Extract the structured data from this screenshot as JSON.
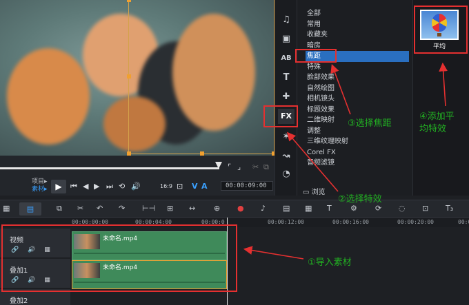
{
  "preview": {
    "alt": "blurred kittens preview"
  },
  "transport": {
    "mode_project": "项目▸",
    "mode_clip": "素材▸",
    "timecode": "00:00:09:00",
    "ratio": "16:9",
    "buttons": [
      "play",
      "home",
      "prev-frame",
      "next-frame",
      "end",
      "repeat",
      "volume"
    ]
  },
  "tools": [
    "music-note-icon",
    "transition-icon",
    "title-icon",
    "graphic-icon",
    "fx",
    "motion-icon",
    "path-icon",
    "speed-icon"
  ],
  "tool_fx_label": "FX",
  "categories": [
    "全部",
    "常用",
    "收藏夹",
    "暗房",
    "焦距",
    "特殊",
    "脸部效果",
    "自然绘图",
    "相机镜头",
    "标题效果",
    "二维映射",
    "调整",
    "三维纹理映射",
    "Corel FX",
    "音频滤镜"
  ],
  "selected_category": "焦距",
  "browse_label": "浏览",
  "effect_thumb": {
    "label": "平均"
  },
  "ruler": [
    "00:00:00:00",
    "00:00:04:00",
    "00:00:0",
    "00:00:12:00",
    "00:00:16:00",
    "00:00:20:00",
    "00:0"
  ],
  "tracks": [
    {
      "name": "视频",
      "clip": "未命名.mp4"
    },
    {
      "name": "叠加1",
      "clip": "未命名.mp4"
    },
    {
      "name": "叠加2"
    }
  ],
  "annotations": {
    "a1": "①导入素材",
    "a2": "②选择特效",
    "a3": "③选择焦距",
    "a4_line1": "④添加平",
    "a4_line2": "均特效"
  },
  "colors": {
    "annotation_red": "#e53030",
    "annotation_green": "#22b022",
    "selected_blue": "#2a6fc0",
    "clip_green": "#3f8a5a"
  }
}
